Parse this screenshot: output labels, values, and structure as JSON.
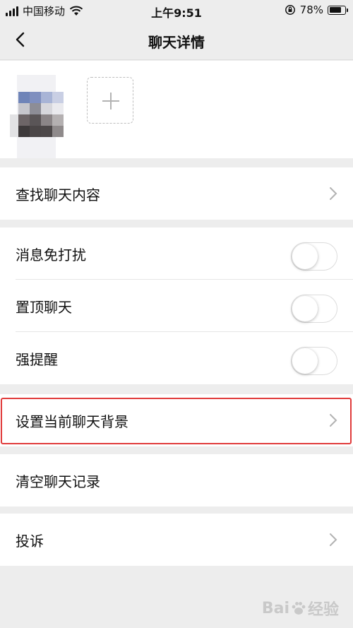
{
  "status_bar": {
    "carrier": "中国移动",
    "time": "上午9:51",
    "battery_percent": "78%",
    "battery_level": 0.78
  },
  "nav": {
    "title": "聊天详情",
    "back_icon": "chevron-left-icon"
  },
  "members": {
    "add_icon": "plus-icon"
  },
  "rows": {
    "search_chat": "查找聊天内容",
    "mute": "消息免打扰",
    "pin": "置顶聊天",
    "strong_remind": "强提醒",
    "set_background": "设置当前聊天背景",
    "clear_history": "清空聊天记录",
    "complain": "投诉"
  },
  "toggles": {
    "mute_on": false,
    "pin_on": false,
    "strong_remind_on": false
  },
  "watermark": {
    "text": "Bai",
    "text2": "经验"
  },
  "colors": {
    "background": "#ededed",
    "highlight": "#e03b3b"
  }
}
